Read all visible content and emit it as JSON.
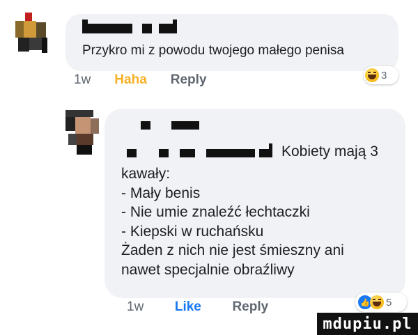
{
  "comment1": {
    "text": "Przykro mi z powodu twojego małego penisa",
    "actions": {
      "time": "1w",
      "reaction": "Haha",
      "reply": "Reply"
    },
    "reactions": {
      "icons": [
        "haha-emoji"
      ],
      "count": "3"
    }
  },
  "comment2": {
    "first_line_tail": "Kobiety mają 3",
    "lines": [
      "kawały:",
      "- Mały benis",
      "- Nie umie znaleźć łechtaczki",
      "- Kiepski w ruchańsku",
      "Żaden z nich nie jest śmieszny ani",
      "nawet specjalnie obraźliwy"
    ],
    "actions": {
      "time": "1w",
      "reaction": "Like",
      "reply": "Reply"
    },
    "reactions": {
      "icons": [
        "like-icon",
        "haha-emoji"
      ],
      "count": "5"
    }
  },
  "watermark": {
    "text": "mdupiu.pl"
  },
  "colors": {
    "bubble": "#f0f2f5",
    "text": "#1c1e21",
    "meta": "#606770",
    "haha": "#f7b125",
    "like": "#1877f2"
  }
}
